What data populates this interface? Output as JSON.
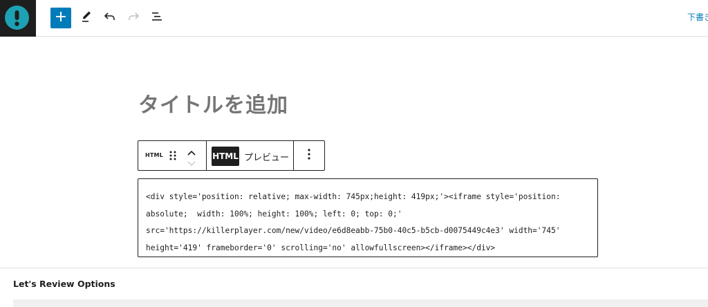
{
  "header": {
    "logo_icon": "exclamation-circle-icon",
    "add_block_icon": "plus-icon",
    "tools_icon": "pencil-icon",
    "undo_icon": "undo-icon",
    "redo_icon": "redo-icon",
    "outline_icon": "list-view-icon",
    "draft_label": "下書き"
  },
  "editor": {
    "title_placeholder": "タイトルを追加",
    "block_toolbar": {
      "block_type_label": "HTML",
      "html_tab_label": "HTML",
      "preview_tab_label": "プレビュー"
    },
    "code_lines": [
      "<div style='position: relative; max-width: 745px;height: 419px;'><iframe style='position:",
      "absolute;  width: 100%; height: 100%; left: 0; top: 0;'",
      "src='https://killerplayer.com/new/video/e6d8eabb-75b0-40c5-b5cb-d0075449c4e3' width='745'",
      "height='419' frameborder='0' scrolling='no' allowfullscreen></iframe></div>"
    ]
  },
  "meta_box": {
    "title": "Let's Review Options"
  },
  "colors": {
    "accent": "#007cba",
    "logo_bg": "#1ca2b4",
    "dark": "#1e1e1e"
  }
}
